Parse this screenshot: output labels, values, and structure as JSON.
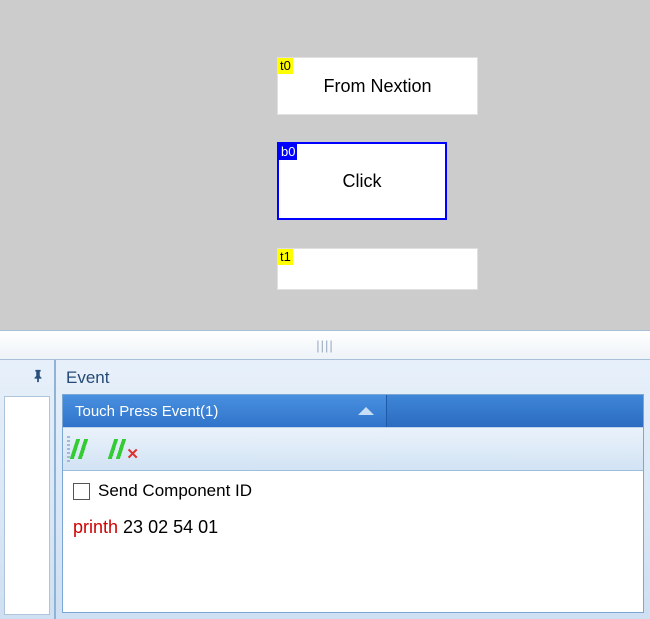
{
  "canvas": {
    "t0": {
      "tag": "t0",
      "text": "From Nextion"
    },
    "b0": {
      "tag": "b0",
      "text": "Click"
    },
    "t1": {
      "tag": "t1",
      "text": ""
    }
  },
  "leftPane": {
    "pin_icon": "⮕"
  },
  "eventPanel": {
    "title": "Event",
    "tab": "Touch Press Event(1)",
    "toolbar": {
      "add": "add-code",
      "delete": "delete-code"
    },
    "sendComponentId": {
      "label": "Send Component ID",
      "checked": false
    },
    "code": {
      "keyword": "printh",
      "args": "23 02 54 01"
    }
  }
}
